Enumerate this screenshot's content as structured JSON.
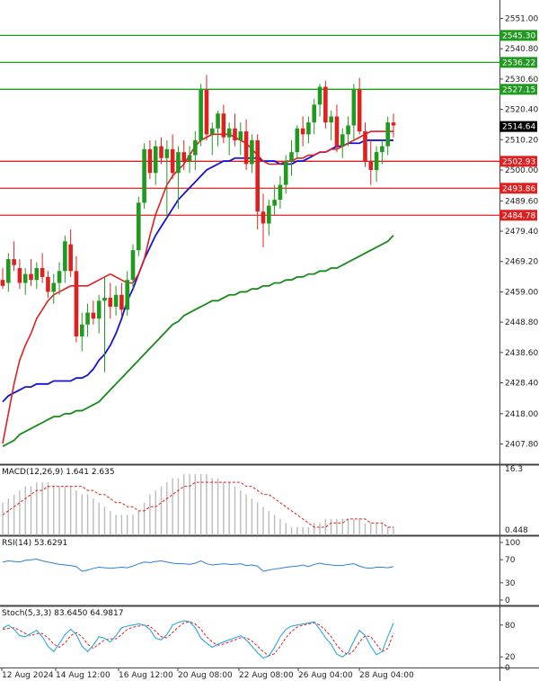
{
  "chart_data": [
    {
      "type": "candlestick",
      "panel": "price",
      "y_ticks": [
        "2551.00",
        "2540.80",
        "2530.60",
        "2520.40",
        "2510.20",
        "2500.00",
        "2489.60",
        "2479.40",
        "2469.20",
        "2459.00",
        "2448.80",
        "2438.60",
        "2428.40",
        "2418.00",
        "2407.80"
      ],
      "ylim": [
        2401,
        2556
      ],
      "last_price": "2514.64",
      "horizontal_levels": [
        {
          "label": "2545.30",
          "value": 2545.3,
          "color": "#1f9a1f"
        },
        {
          "label": "2536.22",
          "value": 2536.22,
          "color": "#1f9a1f"
        },
        {
          "label": "2527.15",
          "value": 2527.15,
          "color": "#1f9a1f"
        },
        {
          "label": "2502.93",
          "value": 2502.93,
          "color": "#e02020"
        },
        {
          "label": "2493.86",
          "value": 2493.86,
          "color": "#e02020"
        },
        {
          "label": "2484.78",
          "value": 2484.78,
          "color": "#e02020"
        }
      ],
      "candles": [
        [
          2463,
          2467,
          2460,
          2461
        ],
        [
          2462,
          2472,
          2459,
          2470
        ],
        [
          2470,
          2476,
          2466,
          2468
        ],
        [
          2467,
          2470,
          2460,
          2462
        ],
        [
          2462,
          2467,
          2458,
          2465
        ],
        [
          2465,
          2470,
          2461,
          2463
        ],
        [
          2463,
          2469,
          2460,
          2467
        ],
        [
          2467,
          2472,
          2462,
          2464
        ],
        [
          2464,
          2466,
          2457,
          2459
        ],
        [
          2459,
          2465,
          2455,
          2462
        ],
        [
          2462,
          2469,
          2458,
          2466
        ],
        [
          2466,
          2478,
          2462,
          2476
        ],
        [
          2475,
          2480,
          2464,
          2466
        ],
        [
          2466,
          2471,
          2442,
          2444
        ],
        [
          2444,
          2452,
          2439,
          2448
        ],
        [
          2448,
          2455,
          2444,
          2452
        ],
        [
          2452,
          2456,
          2448,
          2450
        ],
        [
          2450,
          2458,
          2445,
          2456
        ],
        [
          2456,
          2464,
          2432,
          2457
        ],
        [
          2457,
          2462,
          2450,
          2454
        ],
        [
          2454,
          2461,
          2451,
          2458
        ],
        [
          2458,
          2462,
          2451,
          2453
        ],
        [
          2453,
          2466,
          2451,
          2463
        ],
        [
          2463,
          2475,
          2460,
          2473
        ],
        [
          2473,
          2491,
          2471,
          2489
        ],
        [
          2489,
          2509,
          2487,
          2507
        ],
        [
          2507,
          2510,
          2497,
          2499
        ],
        [
          2499,
          2510,
          2495,
          2508
        ],
        [
          2508,
          2511,
          2502,
          2504
        ],
        [
          2504,
          2510,
          2484,
          2507
        ],
        [
          2507,
          2512,
          2497,
          2499
        ],
        [
          2499,
          2508,
          2487,
          2506
        ],
        [
          2506,
          2510,
          2500,
          2503
        ],
        [
          2503,
          2508,
          2499,
          2505
        ],
        [
          2505,
          2513,
          2500,
          2510
        ],
        [
          2510,
          2529,
          2508,
          2527
        ],
        [
          2527,
          2532,
          2510,
          2512
        ],
        [
          2512,
          2516,
          2505,
          2514
        ],
        [
          2514,
          2520,
          2508,
          2519
        ],
        [
          2519,
          2522,
          2509,
          2511
        ],
        [
          2511,
          2516,
          2505,
          2514
        ],
        [
          2514,
          2519,
          2508,
          2510
        ],
        [
          2510,
          2516,
          2505,
          2513
        ],
        [
          2513,
          2517,
          2500,
          2502
        ],
        [
          2502,
          2512,
          2499,
          2510
        ],
        [
          2510,
          2512,
          2480,
          2486
        ],
        [
          2486,
          2492,
          2474,
          2482
        ],
        [
          2482,
          2490,
          2478,
          2488
        ],
        [
          2488,
          2495,
          2485,
          2490
        ],
        [
          2490,
          2498,
          2487,
          2495
        ],
        [
          2495,
          2505,
          2492,
          2503
        ],
        [
          2503,
          2510,
          2498,
          2506
        ],
        [
          2506,
          2515,
          2504,
          2514
        ],
        [
          2514,
          2518,
          2508,
          2512
        ],
        [
          2512,
          2518,
          2509,
          2516
        ],
        [
          2516,
          2524,
          2512,
          2522
        ],
        [
          2522,
          2529,
          2518,
          2528
        ],
        [
          2528,
          2530,
          2514,
          2516
        ],
        [
          2516,
          2520,
          2510,
          2518
        ],
        [
          2518,
          2522,
          2506,
          2508
        ],
        [
          2508,
          2514,
          2504,
          2512
        ],
        [
          2512,
          2518,
          2508,
          2515
        ],
        [
          2515,
          2529,
          2510,
          2527
        ],
        [
          2527,
          2531,
          2512,
          2513
        ],
        [
          2513,
          2516,
          2501,
          2503
        ],
        [
          2503,
          2510,
          2495,
          2500
        ],
        [
          2500,
          2508,
          2496,
          2506
        ],
        [
          2506,
          2510,
          2502,
          2508
        ],
        [
          2508,
          2518,
          2505,
          2516
        ],
        [
          2516,
          2519,
          2511,
          2515
        ]
      ],
      "ma_fast": [
        2408,
        2418,
        2428,
        2436,
        2441,
        2445,
        2450,
        2453,
        2456,
        2458,
        2459,
        2460,
        2461,
        2461,
        2461,
        2461,
        2462,
        2463,
        2464,
        2465,
        2464,
        2463,
        2462,
        2462,
        2465,
        2470,
        2478,
        2485,
        2490,
        2495,
        2498,
        2500,
        2502,
        2505,
        2508,
        2510,
        2511,
        2512,
        2512,
        2512,
        2512,
        2511,
        2510,
        2509,
        2507,
        2505,
        2503,
        2502,
        2502,
        2502,
        2503,
        2503,
        2504,
        2504,
        2505,
        2505,
        2506,
        2506,
        2507,
        2507,
        2508,
        2509,
        2510,
        2511,
        2512,
        2513,
        2513,
        2513,
        2513,
        2513
      ],
      "ma_mid": [
        2422,
        2424,
        2425,
        2426,
        2427,
        2427,
        2428,
        2428,
        2428,
        2429,
        2429,
        2429,
        2429,
        2430,
        2430,
        2431,
        2433,
        2436,
        2438,
        2441,
        2445,
        2450,
        2456,
        2460,
        2465,
        2470,
        2474,
        2478,
        2481,
        2484,
        2487,
        2490,
        2492,
        2494,
        2496,
        2498,
        2500,
        2501,
        2502,
        2503,
        2503,
        2504,
        2504,
        2504,
        2504,
        2504,
        2503,
        2503,
        2503,
        2502,
        2502,
        2502,
        2503,
        2503,
        2504,
        2505,
        2506,
        2506,
        2507,
        2508,
        2508,
        2509,
        2509,
        2509,
        2510,
        2510,
        2510,
        2510,
        2510,
        2510
      ],
      "ma_slow": [
        2407,
        2408,
        2409,
        2411,
        2412,
        2413,
        2414,
        2415,
        2416,
        2417,
        2417,
        2418,
        2418,
        2419,
        2419,
        2420,
        2421,
        2422,
        2424,
        2426,
        2428,
        2430,
        2432,
        2434,
        2436,
        2438,
        2440,
        2442,
        2444,
        2446,
        2448,
        2449,
        2451,
        2452,
        2453,
        2454,
        2455,
        2456,
        2456,
        2457,
        2458,
        2458,
        2459,
        2459,
        2460,
        2460,
        2461,
        2461,
        2462,
        2462,
        2463,
        2463,
        2464,
        2464,
        2465,
        2465,
        2466,
        2466,
        2467,
        2467,
        2468,
        2469,
        2470,
        2471,
        2472,
        2473,
        2474,
        2475,
        2476,
        2478
      ]
    },
    {
      "type": "bar",
      "panel": "macd",
      "title": "MACD(12,26,9) 1.641 2.635",
      "y_ticks": [
        "16.3",
        "0.448"
      ],
      "ylim": [
        0,
        17
      ],
      "values": [
        8,
        9,
        10,
        11,
        12,
        12,
        13,
        13,
        13,
        12,
        12,
        12,
        12,
        11,
        10,
        10,
        9,
        8,
        7,
        6,
        5,
        5,
        5,
        5,
        6,
        8,
        10,
        11,
        12,
        13,
        14,
        14,
        15,
        15,
        15,
        15,
        15,
        14,
        14,
        13,
        13,
        12,
        11,
        10,
        9,
        8,
        7,
        6,
        5,
        4,
        3,
        2,
        2,
        2,
        2,
        3,
        3,
        4,
        4,
        4,
        4,
        4,
        4,
        4,
        3,
        3,
        3,
        3,
        2,
        2
      ],
      "signal": [
        5,
        6,
        7,
        8,
        9,
        10,
        11,
        11,
        12,
        12,
        12,
        12,
        12,
        12,
        12,
        11,
        11,
        10,
        10,
        9,
        8,
        8,
        7,
        7,
        6,
        6,
        7,
        7,
        8,
        9,
        10,
        11,
        12,
        12,
        13,
        13,
        13,
        13,
        13,
        13,
        13,
        13,
        13,
        12,
        12,
        11,
        10,
        10,
        9,
        8,
        7,
        6,
        5,
        4,
        3,
        2,
        2,
        2,
        3,
        3,
        3,
        4,
        4,
        4,
        4,
        3,
        3,
        3,
        2,
        2
      ]
    },
    {
      "type": "line",
      "panel": "rsi",
      "title": "RSI(14) 53.6291",
      "y_ticks": [
        "100",
        "70",
        "30",
        "0"
      ],
      "ylim": [
        0,
        100
      ],
      "values": [
        66,
        68,
        67,
        66,
        69,
        70,
        71,
        68,
        66,
        64,
        62,
        61,
        60,
        58,
        50,
        52,
        55,
        57,
        56,
        55,
        56,
        57,
        56,
        59,
        63,
        66,
        65,
        67,
        68,
        66,
        64,
        63,
        63,
        62,
        64,
        68,
        63,
        61,
        62,
        63,
        62,
        62,
        63,
        60,
        61,
        59,
        50,
        52,
        54,
        55,
        57,
        58,
        59,
        61,
        58,
        62,
        64,
        62,
        61,
        60,
        60,
        62,
        63,
        59,
        56,
        55,
        57,
        57,
        56,
        58
      ]
    },
    {
      "type": "line",
      "panel": "stoch",
      "title": "Stoch(5,3,3) 83.6450 64.9817",
      "y_ticks": [
        "80",
        "20",
        "0"
      ],
      "ylim": [
        0,
        100
      ],
      "k": [
        74,
        80,
        72,
        60,
        58,
        64,
        70,
        58,
        40,
        30,
        45,
        62,
        72,
        62,
        40,
        30,
        42,
        58,
        55,
        48,
        60,
        75,
        78,
        80,
        82,
        80,
        72,
        55,
        52,
        62,
        80,
        85,
        88,
        86,
        75,
        55,
        46,
        38,
        44,
        48,
        52,
        56,
        60,
        52,
        40,
        28,
        18,
        22,
        38,
        58,
        72,
        78,
        80,
        82,
        84,
        86,
        72,
        56,
        44,
        25,
        20,
        28,
        50,
        70,
        60,
        40,
        24,
        30,
        58,
        84
      ],
      "d": [
        72,
        74,
        75,
        70,
        64,
        60,
        64,
        64,
        56,
        44,
        38,
        46,
        60,
        66,
        58,
        44,
        36,
        44,
        52,
        54,
        54,
        62,
        72,
        76,
        78,
        80,
        78,
        68,
        58,
        56,
        66,
        76,
        84,
        86,
        82,
        72,
        58,
        48,
        42,
        44,
        48,
        52,
        56,
        56,
        50,
        40,
        30,
        22,
        26,
        40,
        56,
        68,
        76,
        80,
        82,
        84,
        80,
        70,
        58,
        42,
        30,
        24,
        32,
        48,
        60,
        58,
        44,
        30,
        36,
        65
      ]
    }
  ],
  "x_ticks": [
    "12 Aug 2024",
    "14 Aug 12:00",
    "16 Aug 12:00",
    "20 Aug 08:00",
    "22 Aug 08:00",
    "26 Aug 04:00",
    "28 Aug 04:00"
  ],
  "colors": {
    "bull": "#1f9a1f",
    "bear": "#e02020",
    "ma_fast": "#e02020",
    "ma_mid": "#1414d4",
    "ma_slow": "#188a18",
    "macd_bar": "#bbbbbb",
    "macd_signal": "#e02020",
    "rsi": "#2e7fd8",
    "stoch_k": "#2aa9d8",
    "stoch_d": "#e02020",
    "last_price_bg": "#000000"
  }
}
